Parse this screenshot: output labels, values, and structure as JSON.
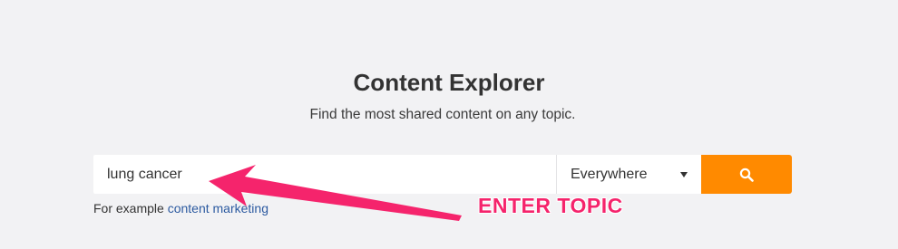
{
  "header": {
    "title": "Content Explorer",
    "subtitle": "Find the most shared content on any topic."
  },
  "search": {
    "query": "lung cancer",
    "scope_selected": "Everywhere",
    "button_icon": "search-icon",
    "button_color": "#ff8a00"
  },
  "example": {
    "prefix": "For example",
    "link_text": "content marketing"
  },
  "annotation": {
    "label": "ENTER TOPIC",
    "color": "#f5246c"
  }
}
